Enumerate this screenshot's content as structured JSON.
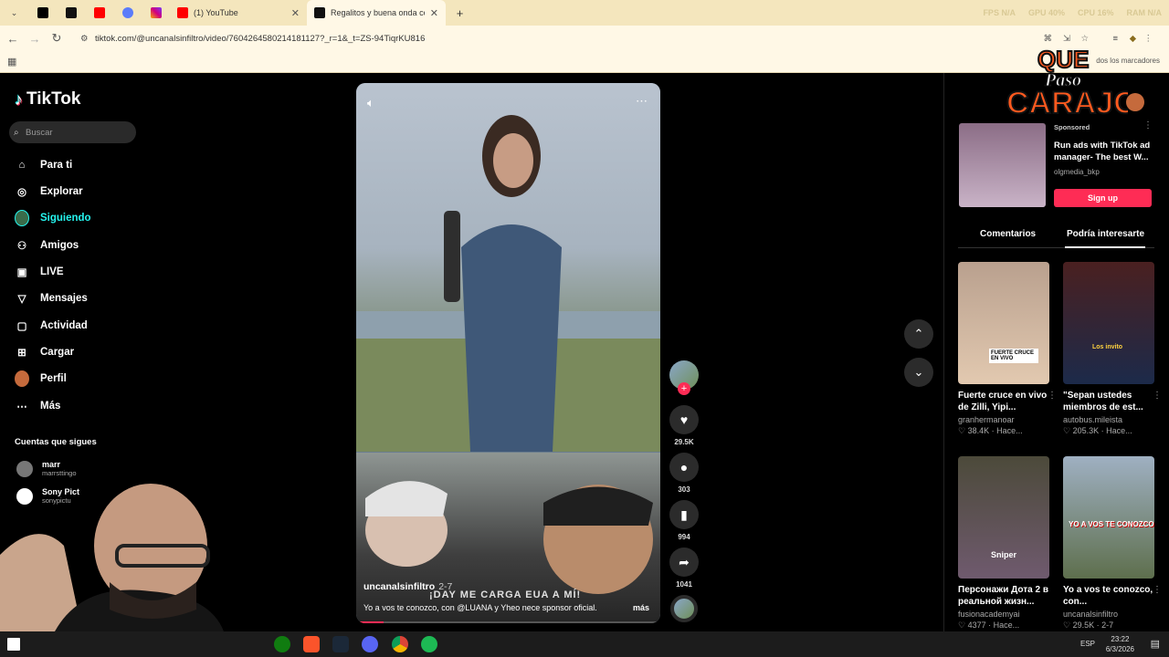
{
  "browser": {
    "tabs": [
      {
        "label": "",
        "icon": "x-icon"
      },
      {
        "label": "",
        "icon": "tiktok-icon"
      },
      {
        "label": "",
        "icon": "youtube-icon"
      },
      {
        "label": "",
        "icon": "messenger-icon"
      },
      {
        "label": "",
        "icon": "instagram-icon"
      },
      {
        "label": "(1) YouTube",
        "icon": "youtube-icon"
      },
      {
        "label": "Regalitos y buena onda con Lu",
        "icon": "tiktok-icon"
      }
    ],
    "perf": [
      "FPS N/A",
      "GPU 40%",
      "CPU 16%",
      "RAM N/A"
    ],
    "url": "tiktok.com/@uncanalsinfiltro/video/7604264580214181127?_r=1&_t=ZS-94TiqrKU816",
    "bookmarks_label": "dos los marcadores"
  },
  "tiktok": {
    "logo": "TikTok",
    "search_placeholder": "Buscar",
    "nav": [
      {
        "label": "Para ti",
        "icon": "home-icon"
      },
      {
        "label": "Explorar",
        "icon": "compass-icon"
      },
      {
        "label": "Siguiendo",
        "icon": "following-avatar-icon"
      },
      {
        "label": "Amigos",
        "icon": "friends-icon"
      },
      {
        "label": "LIVE",
        "icon": "live-icon"
      },
      {
        "label": "Mensajes",
        "icon": "messages-icon"
      },
      {
        "label": "Actividad",
        "icon": "activity-icon"
      },
      {
        "label": "Cargar",
        "icon": "upload-icon"
      },
      {
        "label": "Perfil",
        "icon": "profile-avatar-icon"
      },
      {
        "label": "Más",
        "icon": "more-dots-icon"
      }
    ],
    "following_title": "Cuentas que sigues",
    "following": [
      {
        "name": "marr",
        "handle": "marrsttingo"
      },
      {
        "name": "Sony Pict",
        "handle": "sonypictu"
      }
    ],
    "video": {
      "author": "uncanalsinfiltro",
      "date": "2-7",
      "description": "Yo a vos te conozco, con @LUANA y Yheo nece sponsor oficial.",
      "more": "más",
      "subtitle": "¡DAY ME CARGA EUA A MÍ!"
    },
    "actions": {
      "likes": "29.5K",
      "comments": "303",
      "saves": "994",
      "shares": "1041"
    },
    "ad": {
      "sponsored": "Sponsored",
      "text": "Run ads with TikTok ad manager- The best W...",
      "handle": "olgmedia_bkp",
      "cta": "Sign up"
    },
    "right_tabs": [
      "Comentarios",
      "Podría interesarte"
    ],
    "cards": [
      {
        "caption": "Fuerte cruce en vivo de Zilli, Yipi...",
        "author": "granhermanoar",
        "stat": "38.4K · Hace...",
        "overlay": "FUERTE CRUCE EN VIVO"
      },
      {
        "caption": "\"Sepan ustedes miembros de est...",
        "author": "autobus.mileista",
        "stat": "205.3K · Hace...",
        "overlay": "Los invito"
      },
      {
        "caption": "Персонажи Дота 2 в реальной жизн...",
        "author": "fusionacademyai",
        "stat": "4377 · Hace...",
        "overlay": "Sniper"
      },
      {
        "caption": "Yo a vos te conozco, con...",
        "author": "uncanalsinfiltro",
        "stat": "29.5K · 2-7",
        "overlay": "YO A VOS TE CONOZCO"
      }
    ]
  },
  "brand_overlay": {
    "line1": "QUE",
    "line2": "Paso",
    "line3": "CARAJO"
  },
  "taskbar": {
    "lang": "ESP",
    "time": "23:22",
    "date": "6/3/2026"
  },
  "colors": {
    "accent": "#fe2c55",
    "chrome": "#f4e6bd"
  }
}
